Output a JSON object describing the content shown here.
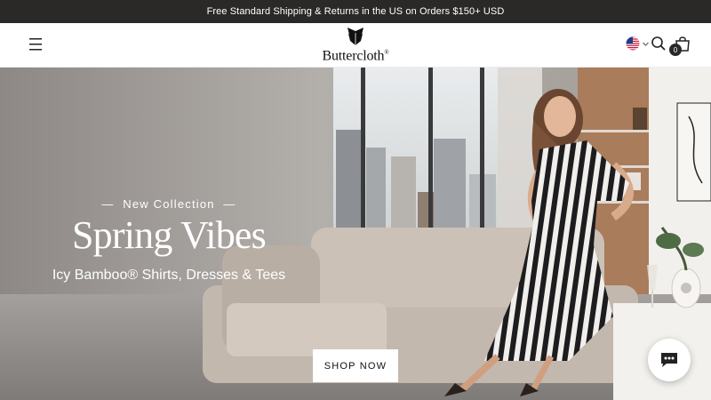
{
  "announcement": {
    "text": "Free Standard Shipping & Returns in the US on Orders $150+ USD"
  },
  "header": {
    "logo_text": "Buttercloth",
    "logo_mark": "®",
    "icons": [
      "hamburger-menu-icon",
      "us-flag-icon",
      "chevron-down-icon",
      "search-icon",
      "shopping-bag-icon"
    ],
    "cart_count": "0"
  },
  "hero": {
    "eyebrow": "New Collection",
    "headline": "Spring Vibes",
    "subhead": "Icy Bamboo® Shirts, Dresses & Tees",
    "cta_label": "SHOP NOW",
    "image_subject": "model in black-and-white striped dress sitting on a beige sofa"
  },
  "chat": {
    "icon": "chat-bubble-icon"
  },
  "colors": {
    "announcement_bg": "#2b2828",
    "announcement_text": "#ffffff",
    "hero_text": "#ffffff",
    "button_bg": "#ffffff",
    "button_text": "#111111"
  }
}
